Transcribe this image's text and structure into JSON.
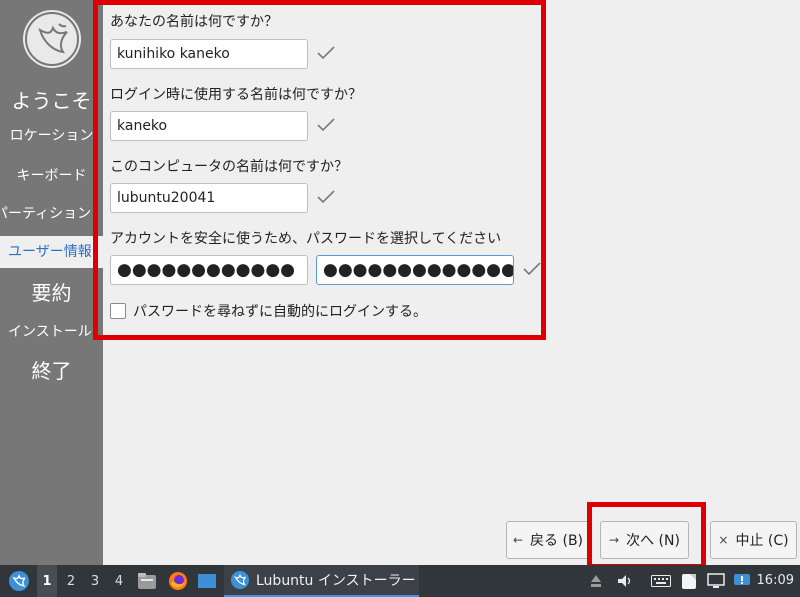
{
  "sidebar": {
    "steps": [
      {
        "label": "ようこそ"
      },
      {
        "label": "ロケーション"
      },
      {
        "label": "キーボード"
      },
      {
        "label": "パーティション"
      },
      {
        "label": "ユーザー情報"
      },
      {
        "label": "要約"
      },
      {
        "label": "インストール"
      },
      {
        "label": "終了"
      }
    ],
    "active_step": "ユーザー情報"
  },
  "form": {
    "name_question": "あなたの名前は何ですか？",
    "name_value": "kunihiko kaneko",
    "login_question": "ログイン時に使用する名前は何ですか？",
    "login_value": "kaneko",
    "computer_question": "このコンピュータの名前は何ですか？",
    "computer_value": "lubuntu20041",
    "password_question": "アカウントを安全に使うため、パスワードを選択してください",
    "password_mask": "●●●●●●●●●●●●",
    "password_confirm_mask": "●●●●●●●●●●●●●",
    "auto_login_label": "パスワードを尋ねずに自動的にログインする。",
    "auto_login_checked": false
  },
  "buttons": {
    "back": "戻る (B)",
    "next": "次へ (N)",
    "cancel": "中止 (C)"
  },
  "taskbar": {
    "desktops": [
      "1",
      "2",
      "3",
      "4"
    ],
    "current_desktop": "1",
    "task_label": "Lubuntu インストーラー",
    "clock": "16:09"
  },
  "colors": {
    "highlight": "#dd0000",
    "sidebar": "#777777",
    "active_step_text": "#2a72c4",
    "taskbar": "#31363b"
  }
}
